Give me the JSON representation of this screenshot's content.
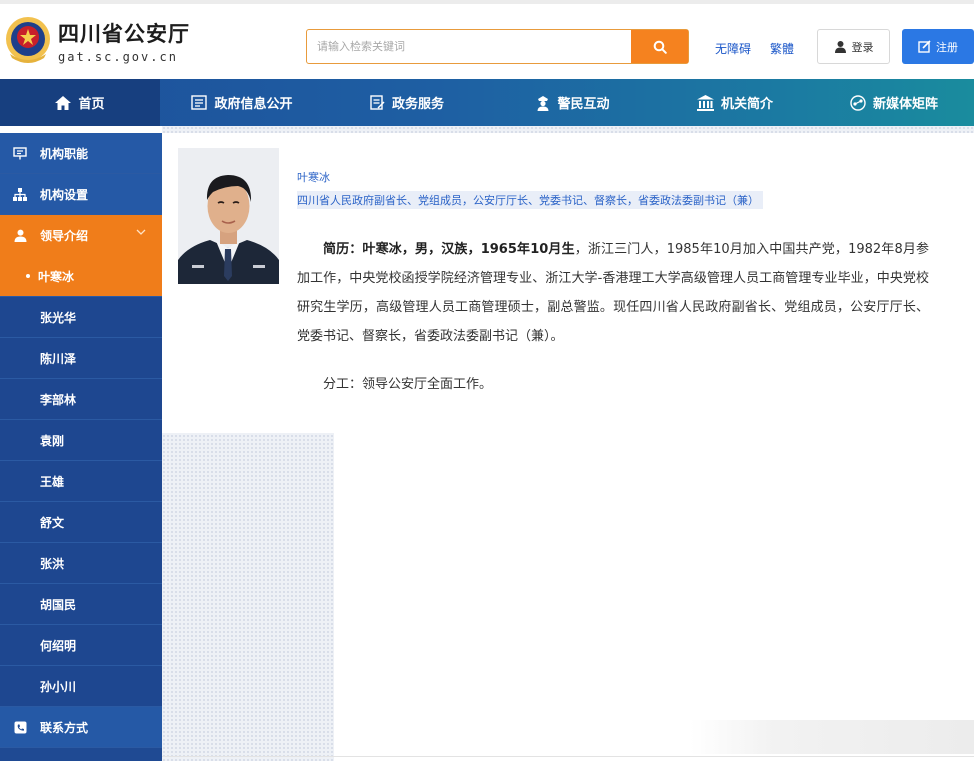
{
  "header": {
    "site_title": "四川省公安厅",
    "site_domain": "gat.sc.gov.cn",
    "search_placeholder": "请输入检索关键词",
    "accessibility_link": "无障碍",
    "traditional_link": "繁體",
    "login_label": "登录",
    "register_label": "注册"
  },
  "nav": {
    "items": [
      {
        "label": "首页",
        "icon": "home-icon"
      },
      {
        "label": "政府信息公开",
        "icon": "document-icon"
      },
      {
        "label": "政务服务",
        "icon": "service-icon"
      },
      {
        "label": "警民互动",
        "icon": "police-icon"
      },
      {
        "label": "机关简介",
        "icon": "building-icon"
      },
      {
        "label": "新媒体矩阵",
        "icon": "media-icon"
      }
    ]
  },
  "sidebar": {
    "sections": [
      {
        "label": "机构职能",
        "icon": "presentation-icon"
      },
      {
        "label": "机构设置",
        "icon": "org-chart-icon"
      },
      {
        "label": "领导介绍",
        "icon": "person-icon"
      }
    ],
    "leaders": [
      "叶寒冰",
      "张光华",
      "陈川泽",
      "李部林",
      "袁刚",
      "王雄",
      "舒文",
      "张洪",
      "胡国民",
      "何绍明",
      "孙小川"
    ],
    "contact": {
      "label": "联系方式",
      "icon": "phone-icon"
    }
  },
  "profile": {
    "name": "叶寒冰",
    "title": "四川省人民政府副省长、党组成员，公安厅厅长、党委书记、督察长，省委政法委副书记（兼）",
    "bio_lead": "简历：叶寒冰，男，汉族，1965年10月生",
    "bio_rest": "，浙江三门人，1985年10月加入中国共产党，1982年8月参加工作，中央党校函授学院经济管理专业、浙江大学-香港理工大学高级管理人员工商管理专业毕业，中央党校研究生学历，高级管理人员工商管理硕士，副总警监。现任四川省人民政府副省长、党组成员，公安厅厅长、党委书记、督察长，省委政法委副书记（兼）。",
    "duty": "分工：领导公安厅全面工作。"
  },
  "colors": {
    "nav_start": "#1d4f9a",
    "nav_end": "#1a8c9e",
    "sidebar": "#1f4a93",
    "accent_orange": "#f07d1a",
    "link_blue": "#2b63c7",
    "register_blue": "#2b78e4"
  }
}
